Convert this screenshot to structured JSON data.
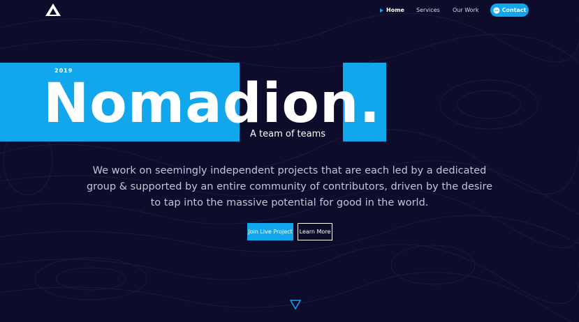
{
  "nav": {
    "home": "Home",
    "services": "Services",
    "our_work": "Our Work",
    "contact": "Contact"
  },
  "hero": {
    "year": "2019",
    "title": "Nomadion.",
    "tagline": "A team of teams",
    "description": "We work on seemingly independent projects that are each led by a dedicated group & supported by an entire community of contributors, driven by the desire to tap into the massive potential for good in the world.",
    "join_button": "Join Live Project",
    "learn_button": "Learn More"
  },
  "icons": {
    "logo": "triangle-logo-icon",
    "nav_active": "arrow-right-icon",
    "contact": "chat-icon",
    "scroll": "chevron-down-icon"
  },
  "colors": {
    "background": "#0d0c2a",
    "accent": "#12a6ec",
    "text": "#ffffff",
    "muted_text": "#c2c4d6"
  }
}
